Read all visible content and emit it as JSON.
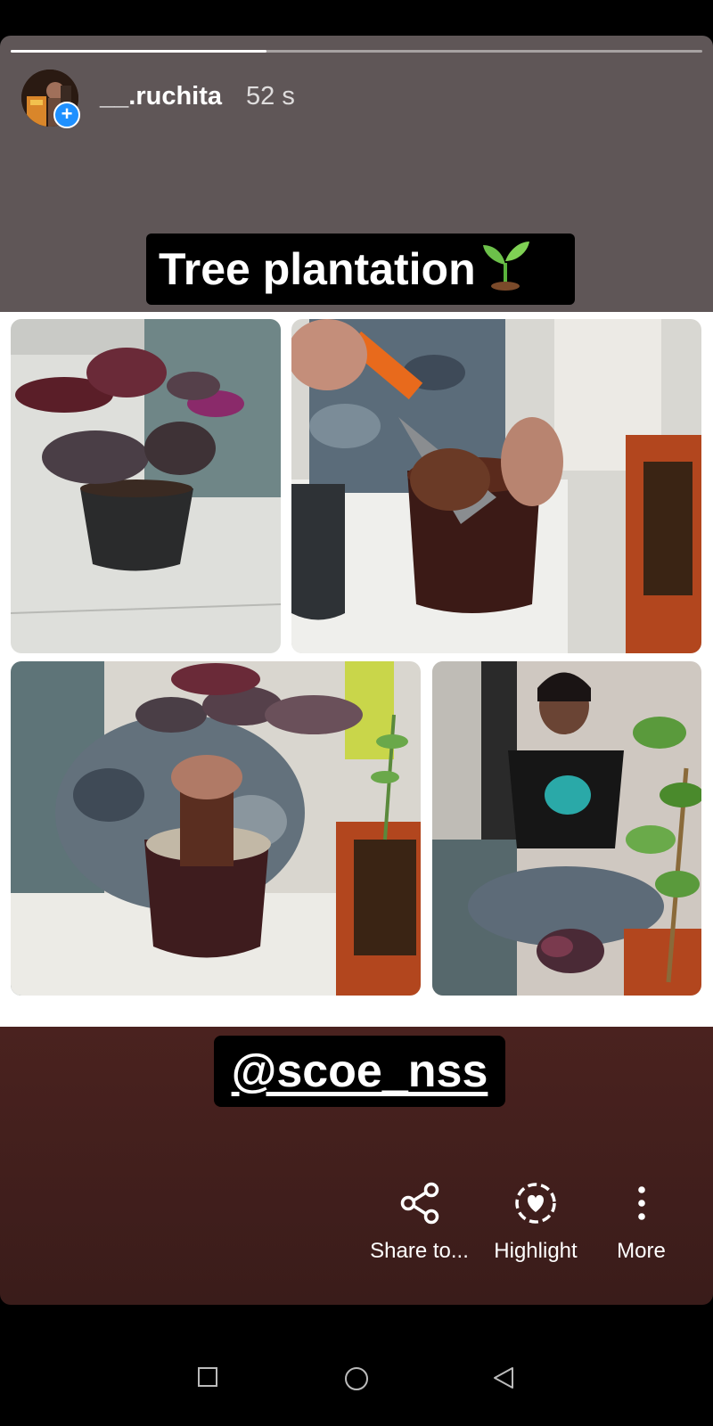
{
  "story": {
    "username": "__.ruchita",
    "time_ago": "52 s",
    "progress": 0.37,
    "title_sticker": "Tree plantation",
    "mention_sticker": "@scoe_nss"
  },
  "actions": {
    "share_label": "Share to...",
    "highlight_label": "Highlight",
    "more_label": "More"
  },
  "icons": {
    "sprout": "sprout-icon",
    "share": "share-icon",
    "highlight": "highlight-heart-icon",
    "more": "more-vertical-icon",
    "nav_recents": "square-icon",
    "nav_home": "circle-icon",
    "nav_back": "triangle-back-icon"
  },
  "colors": {
    "accent_blue": "#1e90ff",
    "top_background": "#5f5657",
    "bottom_background": "#4a221f"
  }
}
